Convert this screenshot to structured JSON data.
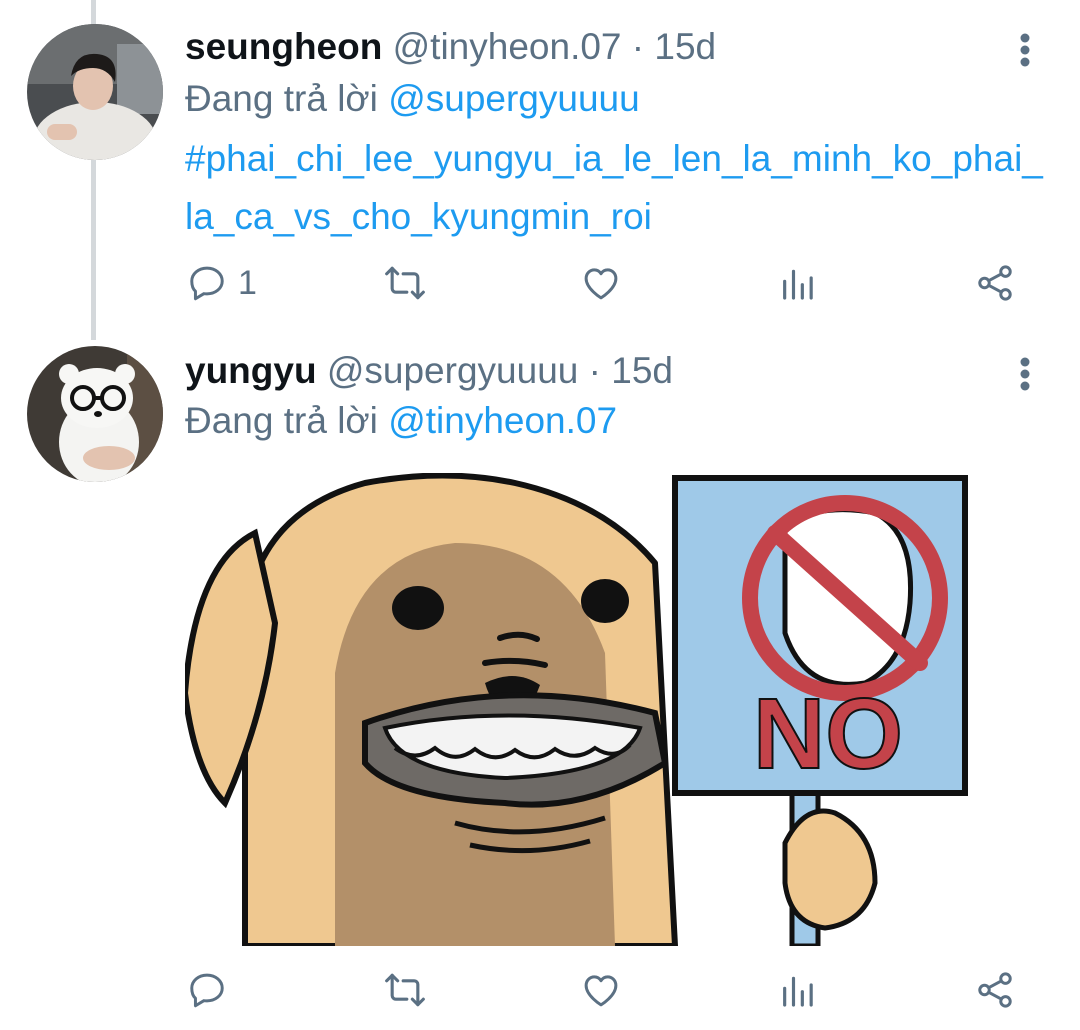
{
  "tweets": [
    {
      "name": "seungheon",
      "handle": "@tinyheon.07",
      "time_sep": "·",
      "time": "15d",
      "replying_prefix": "Đang trả lời",
      "replying_to": "@supergyuuuu",
      "text": "#phai_chi_lee_yungyu_ia_le_len_la_minh_ko_phai_la_ca_vs_cho_kyungmin_roi",
      "actions": {
        "reply_count": "1"
      },
      "avatar_icon": "person-photo"
    },
    {
      "name": "yungyu",
      "handle": "@supergyuuuu",
      "time_sep": "·",
      "time": "15d",
      "replying_prefix": "Đang trả lời",
      "replying_to": "@tinyheon.07",
      "media": {
        "sign_text": "NO",
        "subject": "dog-holding-no-sign"
      },
      "avatar_icon": "bear-figure-photo"
    }
  ],
  "colors": {
    "link": "#1d9bf0",
    "secondary": "#5b7083",
    "primary": "#0f1419",
    "thread_line": "#d4d8db"
  }
}
